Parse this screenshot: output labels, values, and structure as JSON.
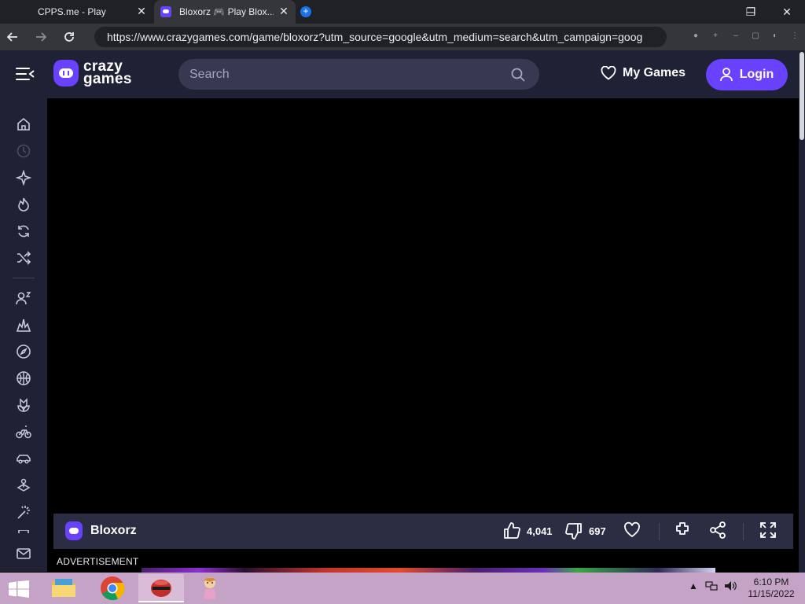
{
  "browser": {
    "tabs": [
      {
        "title": "CPPS.me - Play",
        "active": false
      },
      {
        "title": "Bloxorz 🎮 Play Blox...",
        "active": true
      }
    ],
    "url": "https://www.crazygames.com/game/bloxorz?utm_source=google&utm_medium=search&utm_campaign=goog",
    "window_controls": {
      "minimize": "─",
      "restore": "❐",
      "close": "✕"
    }
  },
  "header": {
    "logo_line1": "crazy",
    "logo_line2": "games",
    "search_placeholder": "Search",
    "my_games_label": "My Games",
    "login_label": "Login",
    "accent_color": "#6842ff"
  },
  "sidebar": {
    "icons": [
      "home-icon",
      "recent-icon",
      "new-icon",
      "trending-icon",
      "updated-icon",
      "random-icon",
      "multiplayer-icon",
      "action-icon",
      "adventure-icon",
      "basketball-icon",
      "casual-icon",
      "bike-icon",
      "car-icon",
      "clicker-icon",
      "magic-icon",
      "mail-icon"
    ]
  },
  "game": {
    "title": "Bloxorz",
    "likes": "4,041",
    "dislikes": "697"
  },
  "ad": {
    "label": "ADVERTISEMENT"
  },
  "taskbar": {
    "apps": [
      "file-explorer",
      "chrome",
      "game-app",
      "character-app"
    ],
    "clock_time": "6:10 PM",
    "clock_date": "11/15/2022"
  }
}
